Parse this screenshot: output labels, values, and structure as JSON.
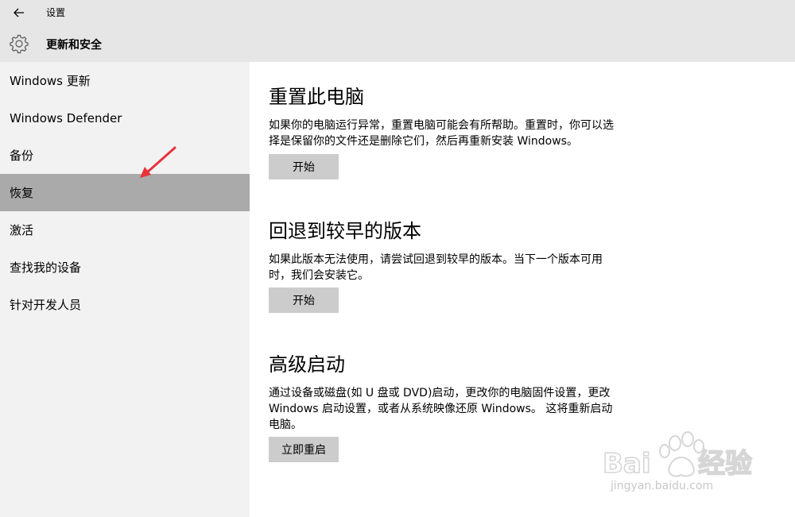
{
  "header": {
    "app_title": "设置",
    "section_title": "更新和安全"
  },
  "sidebar": {
    "items": [
      {
        "label": "Windows 更新",
        "selected": false
      },
      {
        "label": "Windows Defender",
        "selected": false
      },
      {
        "label": "备份",
        "selected": false
      },
      {
        "label": "恢复",
        "selected": true
      },
      {
        "label": "激活",
        "selected": false
      },
      {
        "label": "查找我的设备",
        "selected": false
      },
      {
        "label": "针对开发人员",
        "selected": false
      }
    ]
  },
  "main": {
    "sections": [
      {
        "title": "重置此电脑",
        "description": "如果你的电脑运行异常，重置电脑可能会有所帮助。重置时，你可以选择是保留你的文件还是删除它们，然后再重新安装 Windows。",
        "button": "开始"
      },
      {
        "title": "回退到较早的版本",
        "description": "如果此版本无法使用，请尝试回退到较早的版本。当下一个版本可用时，我们会安装它。",
        "button": "开始"
      },
      {
        "title": "高级启动",
        "description": "通过设备或磁盘(如 U 盘或 DVD)启动，更改你的电脑固件设置，更改 Windows 启动设置，或者从系统映像还原 Windows。 这将重新启动电脑。",
        "button": "立即重启"
      }
    ]
  },
  "watermark": {
    "text": "jingyan.baidu.com"
  },
  "colors": {
    "header_bg": "#e6e6e6",
    "sidebar_bg": "#f2f2f2",
    "selected_bg": "#aaaaaa",
    "button_bg": "#cccccc",
    "arrow": "#e8323c"
  }
}
